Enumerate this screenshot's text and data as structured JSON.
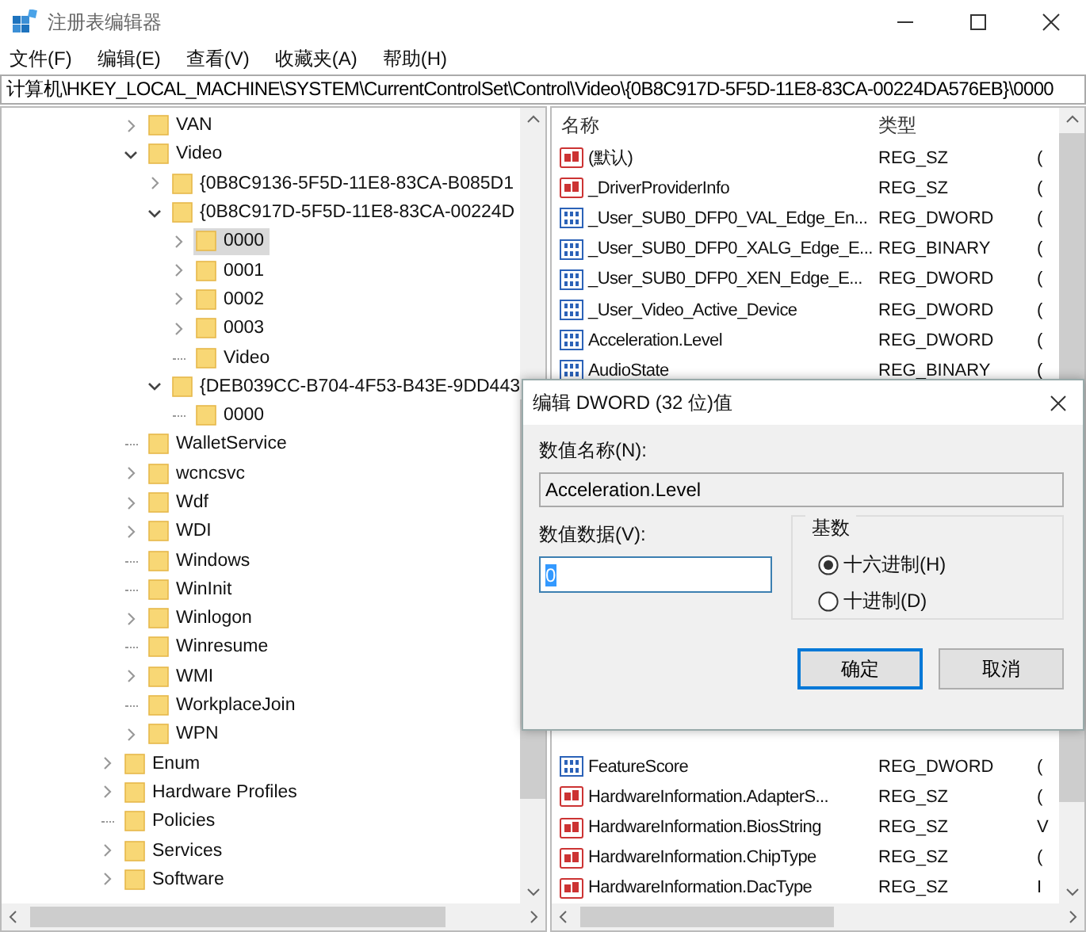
{
  "window": {
    "title": "注册表编辑器"
  },
  "menu": [
    "文件(F)",
    "编辑(E)",
    "查看(V)",
    "收藏夹(A)",
    "帮助(H)"
  ],
  "address": {
    "value": "计算机\\HKEY_LOCAL_MACHINE\\SYSTEM\\CurrentControlSet\\Control\\Video\\{0B8C917D-5F5D-11E8-83CA-00224DA576EB}\\0000"
  },
  "tree": {
    "upper": [
      {
        "label": "VAN",
        "has_children": true,
        "expanded": false,
        "selected": false
      },
      {
        "label": "Video",
        "has_children": true,
        "expanded": true,
        "selected": false,
        "children": [
          {
            "label": "{0B8C9136-5F5D-11E8-83CA-B085D1",
            "has_children": true,
            "expanded": false,
            "selected": false
          },
          {
            "label": "{0B8C917D-5F5D-11E8-83CA-00224D",
            "has_children": true,
            "expanded": true,
            "selected": false,
            "children": [
              {
                "label": "0000",
                "has_children": true,
                "expanded": false,
                "selected": true
              },
              {
                "label": "0001",
                "has_children": true,
                "expanded": false,
                "selected": false
              },
              {
                "label": "0002",
                "has_children": true,
                "expanded": false,
                "selected": false
              },
              {
                "label": "0003",
                "has_children": true,
                "expanded": false,
                "selected": false
              },
              {
                "label": "Video",
                "has_children": false,
                "expanded": false,
                "selected": false
              }
            ]
          },
          {
            "label": "{DEB039CC-B704-4F53-B43E-9DD443",
            "has_children": true,
            "expanded": true,
            "selected": false,
            "children": [
              {
                "label": "0000",
                "has_children": false,
                "expanded": false,
                "selected": false
              }
            ]
          }
        ]
      },
      {
        "label": "WalletService",
        "has_children": false,
        "expanded": false,
        "selected": false
      },
      {
        "label": "wcncsvc",
        "has_children": true,
        "expanded": false,
        "selected": false
      },
      {
        "label": "Wdf",
        "has_children": true,
        "expanded": false,
        "selected": false
      },
      {
        "label": "WDI",
        "has_children": true,
        "expanded": false,
        "selected": false
      },
      {
        "label": "Windows",
        "has_children": false,
        "expanded": false,
        "selected": false
      },
      {
        "label": "WinInit",
        "has_children": false,
        "expanded": false,
        "selected": false
      },
      {
        "label": "Winlogon",
        "has_children": true,
        "expanded": false,
        "selected": false
      },
      {
        "label": "Winresume",
        "has_children": false,
        "expanded": false,
        "selected": false
      },
      {
        "label": "WMI",
        "has_children": true,
        "expanded": false,
        "selected": false
      },
      {
        "label": "WorkplaceJoin",
        "has_children": false,
        "expanded": false,
        "selected": false
      },
      {
        "label": "WPN",
        "has_children": true,
        "expanded": false,
        "selected": false
      }
    ],
    "lower": [
      {
        "label": "Enum",
        "has_children": true,
        "expanded": false,
        "selected": false
      },
      {
        "label": "Hardware Profiles",
        "has_children": true,
        "expanded": false,
        "selected": false
      },
      {
        "label": "Policies",
        "has_children": false,
        "expanded": false,
        "selected": false
      },
      {
        "label": "Services",
        "has_children": true,
        "expanded": false,
        "selected": false
      },
      {
        "label": "Software",
        "has_children": true,
        "expanded": false,
        "selected": false
      }
    ]
  },
  "values": {
    "columns": [
      "名称",
      "类型"
    ],
    "rows_top": [
      {
        "name": "(默认)",
        "type": "REG_SZ",
        "column_3": "(",
        "kind": "string"
      },
      {
        "name": "_DriverProviderInfo",
        "type": "REG_SZ",
        "column_3": "(",
        "kind": "string"
      },
      {
        "name": "_User_SUB0_DFP0_VAL_Edge_En...",
        "type": "REG_DWORD",
        "column_3": "(",
        "kind": "number"
      },
      {
        "name": "_User_SUB0_DFP0_XALG_Edge_E...",
        "type": "REG_BINARY",
        "column_3": "(",
        "kind": "number"
      },
      {
        "name": "_User_SUB0_DFP0_XEN_Edge_E...",
        "type": "REG_DWORD",
        "column_3": "(",
        "kind": "number"
      },
      {
        "name": "_User_Video_Active_Device",
        "type": "REG_DWORD",
        "column_3": "(",
        "kind": "number"
      },
      {
        "name": "Acceleration.Level",
        "type": "REG_DWORD",
        "column_3": "(",
        "kind": "number"
      },
      {
        "name": "AudioState",
        "type": "REG_BINARY",
        "column_3": "(",
        "kind": "number"
      }
    ],
    "rows_bottom": [
      {
        "name": "FeatureScore",
        "type": "REG_DWORD",
        "column_3": "(",
        "kind": "number"
      },
      {
        "name": "HardwareInformation.AdapterS...",
        "type": "REG_SZ",
        "column_3": "(",
        "kind": "string"
      },
      {
        "name": "HardwareInformation.BiosString",
        "type": "REG_SZ",
        "column_3": "V",
        "kind": "string"
      },
      {
        "name": "HardwareInformation.ChipType",
        "type": "REG_SZ",
        "column_3": "(",
        "kind": "string"
      },
      {
        "name": "HardwareInformation.DacType",
        "type": "REG_SZ",
        "column_3": "I",
        "kind": "string"
      }
    ]
  },
  "dialog": {
    "title": "编辑 DWORD (32 位)值",
    "name_label": "数值名称(N):",
    "name_value": "Acceleration.Level",
    "data_label": "数值数据(V):",
    "data_value": "0",
    "base": {
      "title": "基数",
      "options": [
        {
          "label": "十六进制(H)",
          "selected": true
        },
        {
          "label": "十进制(D)",
          "selected": false
        }
      ]
    },
    "buttons": [
      {
        "label": "确定",
        "default": true
      },
      {
        "label": "取消",
        "default": false
      }
    ]
  }
}
